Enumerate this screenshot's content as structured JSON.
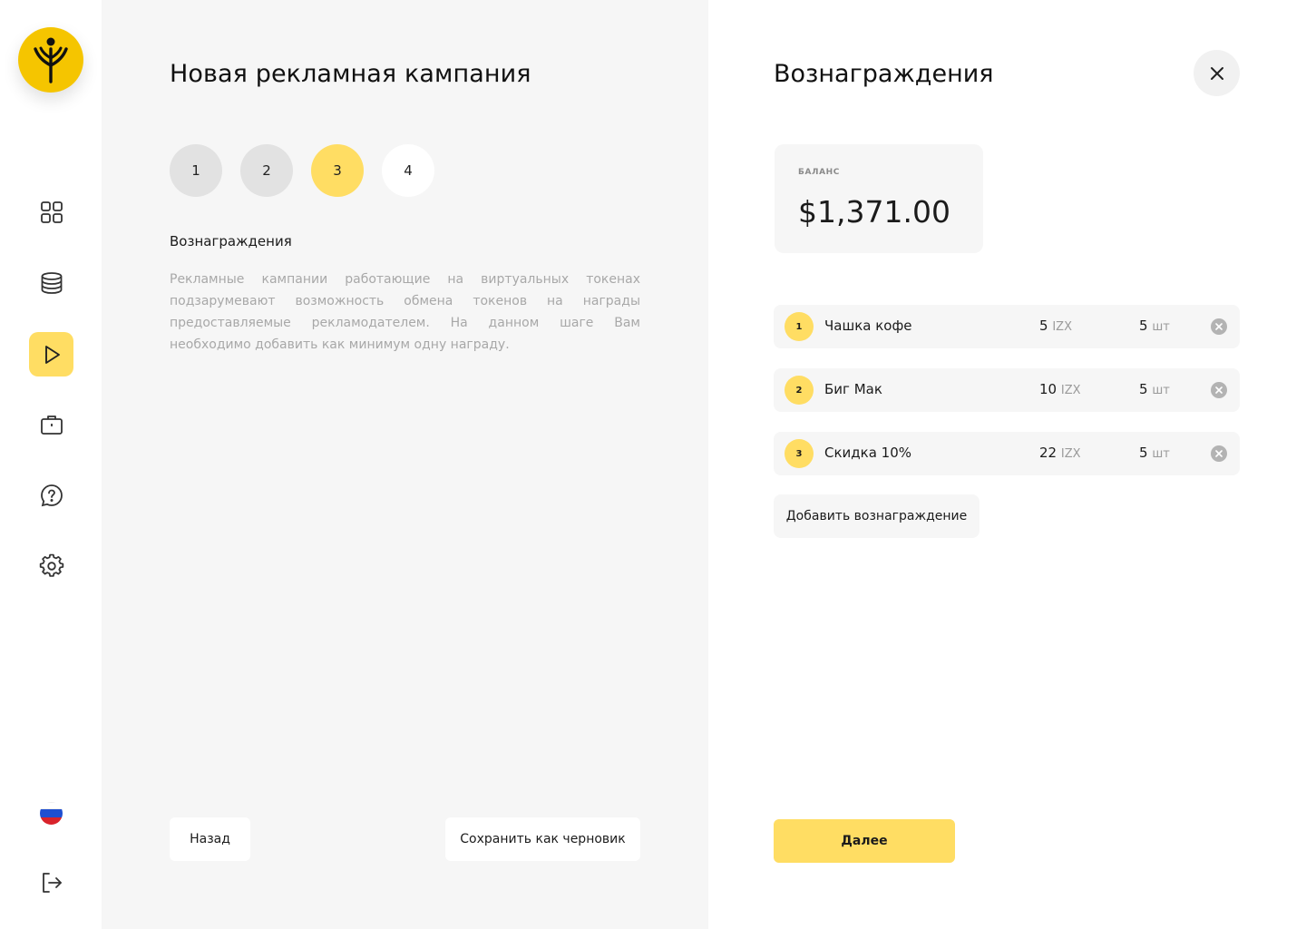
{
  "sidebar": {
    "items": [
      {
        "icon": "dashboard-grid-icon",
        "active": false
      },
      {
        "icon": "database-icon",
        "active": false
      },
      {
        "icon": "play-icon",
        "active": true
      },
      {
        "icon": "briefcase-icon",
        "active": false
      },
      {
        "icon": "help-chat-icon",
        "active": false
      },
      {
        "icon": "gear-icon",
        "active": false
      }
    ],
    "language_icon": "russian-flag-icon",
    "logout_icon": "logout-icon"
  },
  "wizard": {
    "title": "Новая рекламная кампания",
    "steps": [
      "1",
      "2",
      "3",
      "4"
    ],
    "current_step": 3,
    "section_title": "Вознаграждения",
    "section_description": "Рекламные кампании работающие на виртуальных токенах подзарумевают возможность обмена токенов на награды предоставляемые рекламодателем. На данном шаге Вам необходимо добавить как минимум одну награду.",
    "back_label": "Назад",
    "save_draft_label": "Сохранить как черновик"
  },
  "rewards_panel": {
    "title": "Вознаграждения",
    "balance_label": "БАЛАНС",
    "balance_value": "$1,371.00",
    "rewards": [
      {
        "num": "1",
        "name": "Чашка кофе",
        "price": "5",
        "price_unit": "IZX",
        "qty": "5",
        "qty_unit": "шт"
      },
      {
        "num": "2",
        "name": "Биг Мак",
        "price": "10",
        "price_unit": "IZX",
        "qty": "5",
        "qty_unit": "шт"
      },
      {
        "num": "3",
        "name": "Скидка 10%",
        "price": "22",
        "price_unit": "IZX",
        "qty": "5",
        "qty_unit": "шт"
      }
    ],
    "add_label": "Добавить вознаграждение",
    "next_label": "Далее"
  },
  "colors": {
    "accent": "#ffdd63",
    "logo": "#f5c500",
    "panel_bg": "#f6f6f6"
  }
}
